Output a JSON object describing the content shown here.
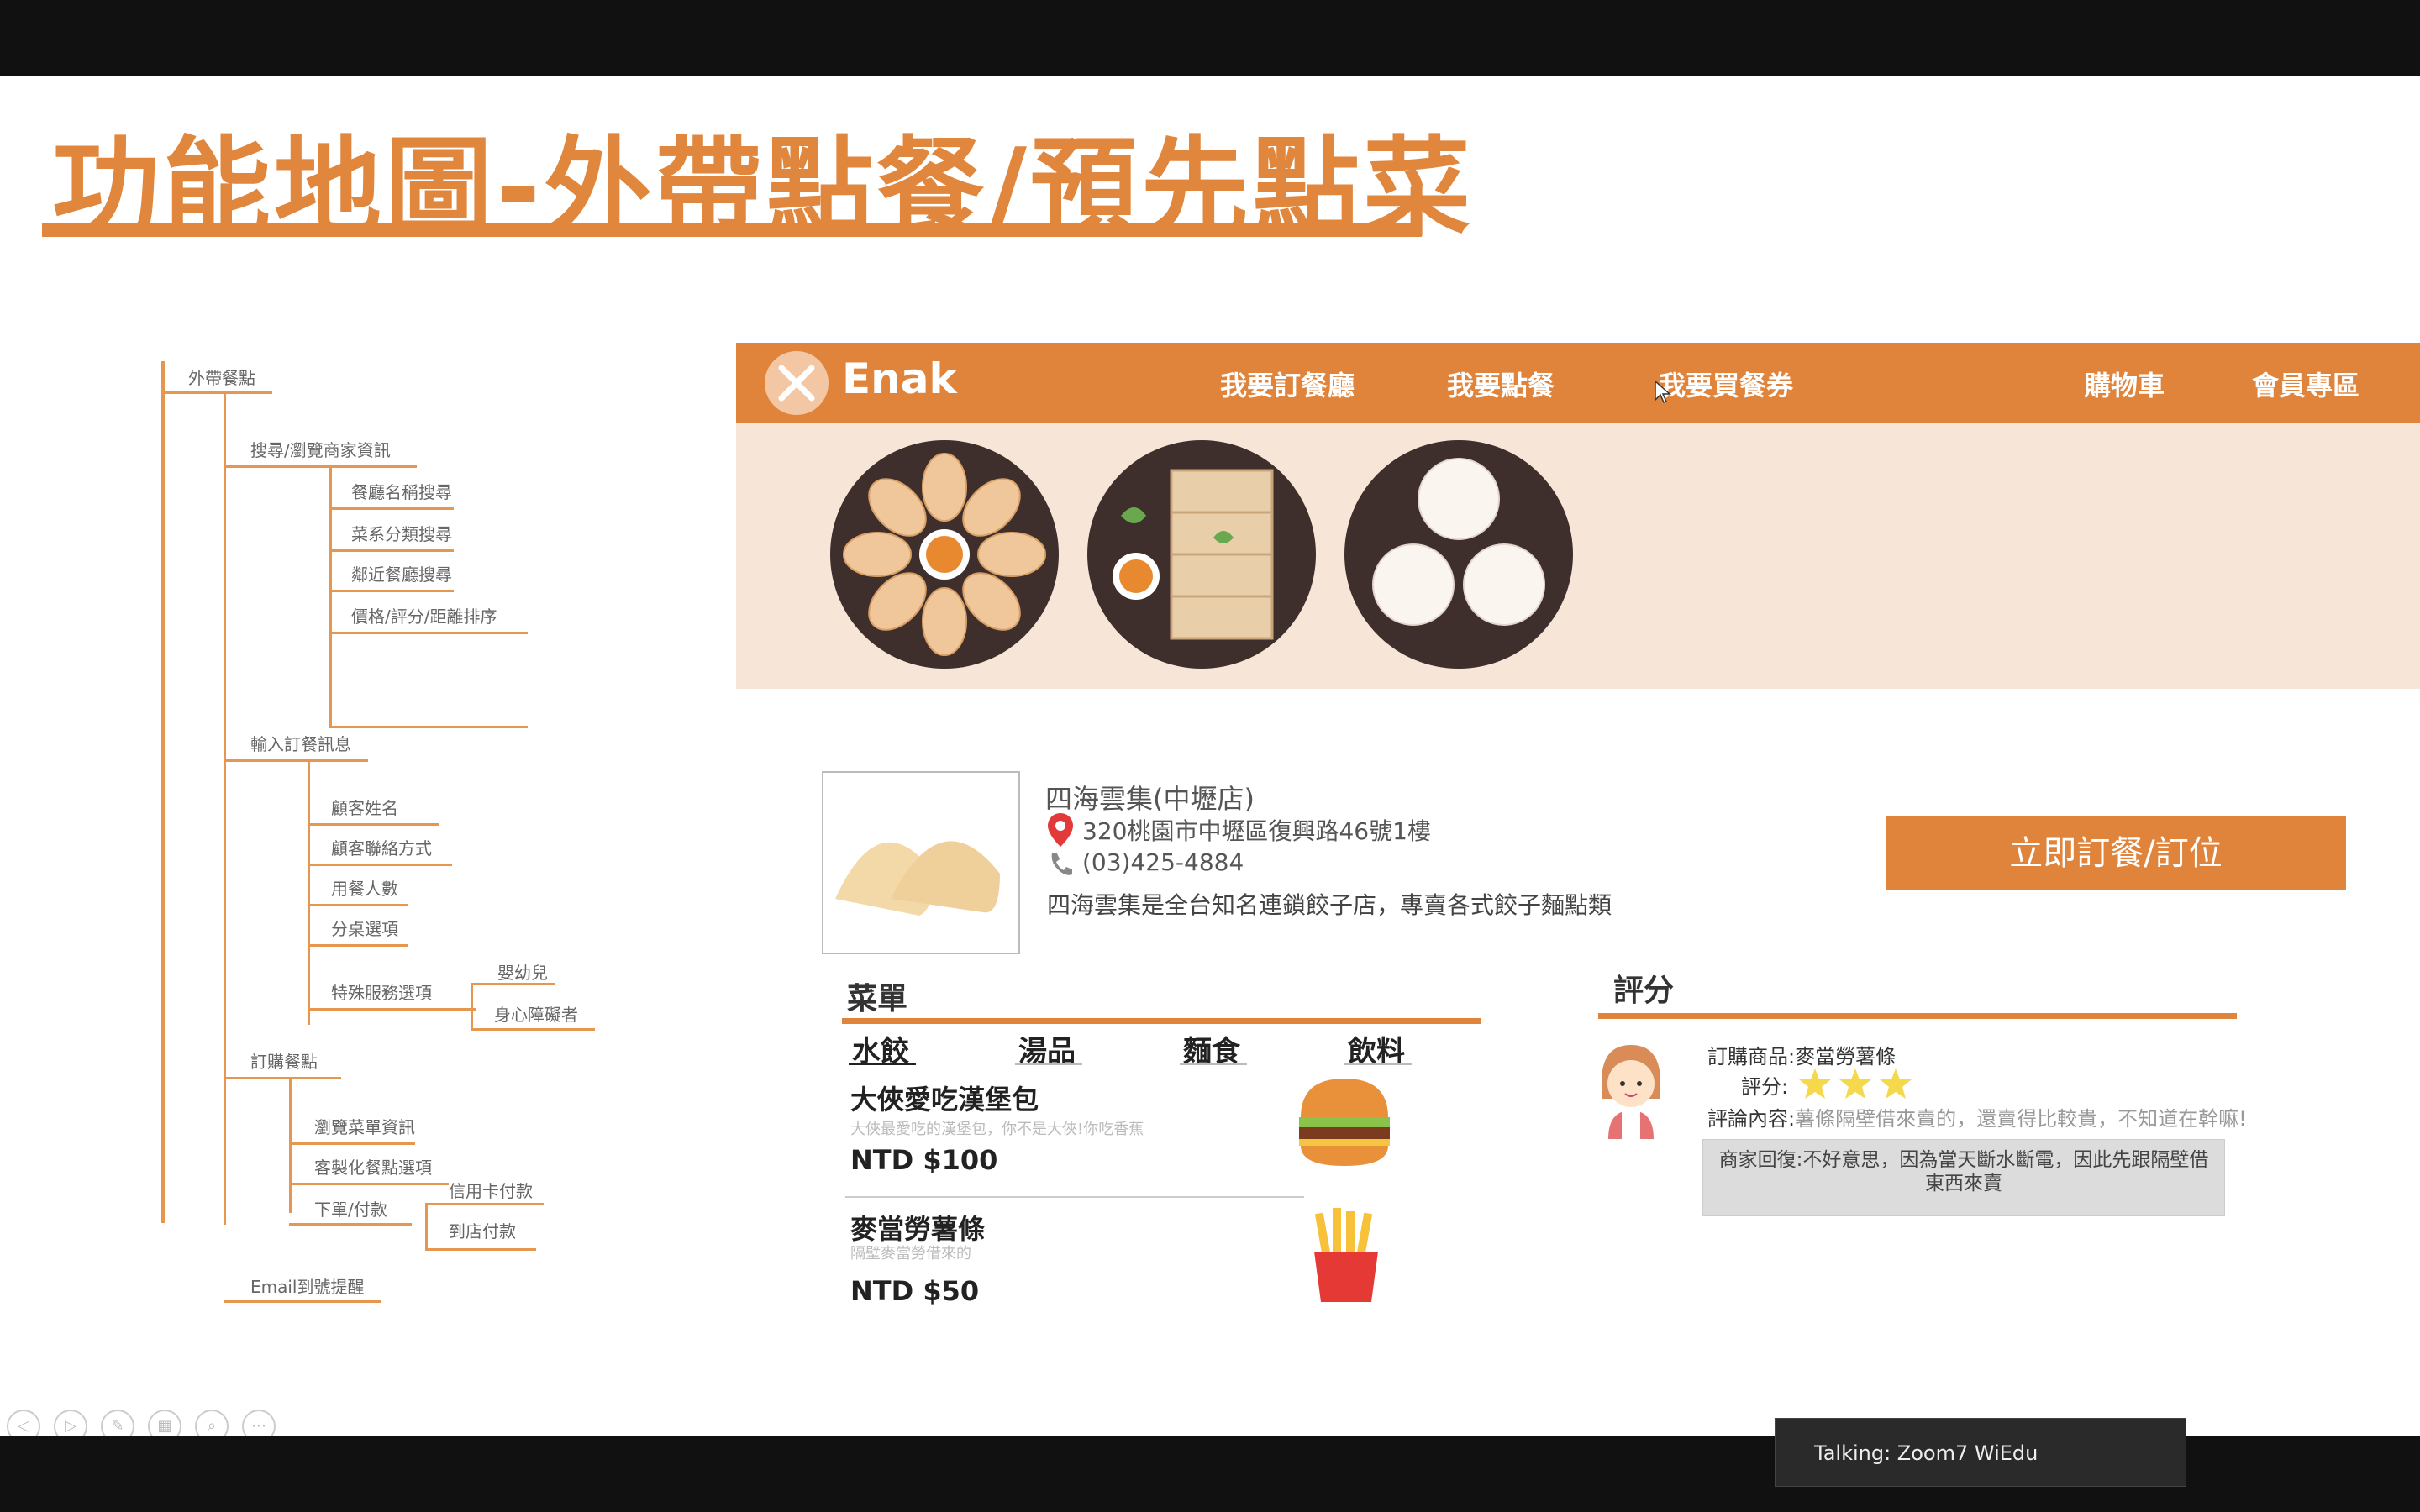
{
  "slide": {
    "title": "功能地圖-外帶點餐/預先點菜",
    "mindmap": {
      "root": "外帶餐點",
      "level1": [
        "搜尋/瀏覽商家資訊",
        "輸入訂餐訊息",
        "訂購餐點",
        "Email到號提醒"
      ],
      "search_children": [
        "餐廳名稱搜尋",
        "菜系分類搜尋",
        "鄰近餐廳搜尋",
        "價格/評分/距離排序"
      ],
      "order_info_children": [
        "顧客姓名",
        "顧客聯絡方式",
        "用餐人數",
        "分桌選項",
        "特殊服務選項"
      ],
      "special_children": [
        "嬰幼兒",
        "身心障礙者"
      ],
      "order_children": [
        "瀏覽菜單資訊",
        "客製化餐點選項",
        "下單/付款"
      ],
      "payment_children": [
        "信用卡付款",
        "到店付款"
      ]
    },
    "mockup": {
      "logo": "Enak",
      "nav": [
        "我要訂餐廳",
        "我要點餐",
        "我要買餐券",
        "購物車",
        "會員專區"
      ],
      "shop": {
        "name": "四海雲集(中壢店)",
        "address": "320桃園市中壢區復興路46號1樓",
        "phone": "(03)425-4884",
        "description": "四海雲集是全台知名連鎖餃子店，專賣各式餃子麵點類"
      },
      "order_button": "立即訂餐/訂位",
      "menu": {
        "title": "菜單",
        "tabs": [
          "水餃",
          "湯品",
          "麵食",
          "飲料"
        ],
        "items": [
          {
            "name": "大俠愛吃漢堡包",
            "desc": "大俠最愛吃的漢堡包，你不是大俠!你吃香蕉",
            "price": "NTD $100"
          },
          {
            "name": "麥當勞薯條",
            "desc": "隔壁麥當勞借來的",
            "price": "NTD $50"
          }
        ]
      },
      "review": {
        "title": "評分",
        "product_label": "訂購商品:麥當勞薯條",
        "rating_label": "評分:",
        "rating": 3,
        "content_label": "評論內容:",
        "content": "薯條隔壁借來賣的，還賣得比較貴，不知道在幹嘛!",
        "reply": "商家回復:不好意思，因為當天斷水斷電，因此先跟隔壁借東西來賣"
      }
    }
  },
  "talking": "Talking: Zoom7 WiEdu",
  "colors": {
    "accent": "#e0843c",
    "hero_bg": "#f7e6d8",
    "dish_bg": "#3e2f2d"
  }
}
